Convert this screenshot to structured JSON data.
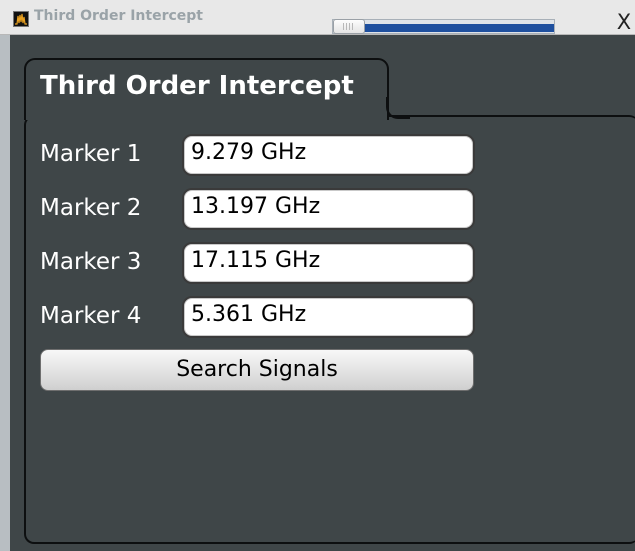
{
  "window": {
    "title": "Third Order Intercept",
    "close_label": "X"
  },
  "tab": {
    "label": "Third Order Intercept"
  },
  "markers": [
    {
      "label": "Marker 1",
      "value": "9.279 GHz"
    },
    {
      "label": "Marker 2",
      "value": "13.197 GHz"
    },
    {
      "label": "Marker 3",
      "value": "17.115 GHz"
    },
    {
      "label": "Marker 4",
      "value": "5.361 GHz"
    }
  ],
  "actions": {
    "search_label": "Search Signals"
  },
  "transparency_slider": {
    "level_percent": 14
  },
  "colors": {
    "background": "#3f4648",
    "slider_fill": "#1e4f9e",
    "text": "#ffffff"
  },
  "icons": {
    "app": "spectrum-trace-icon",
    "close": "close-icon",
    "slider_grip": "grip-icon"
  }
}
